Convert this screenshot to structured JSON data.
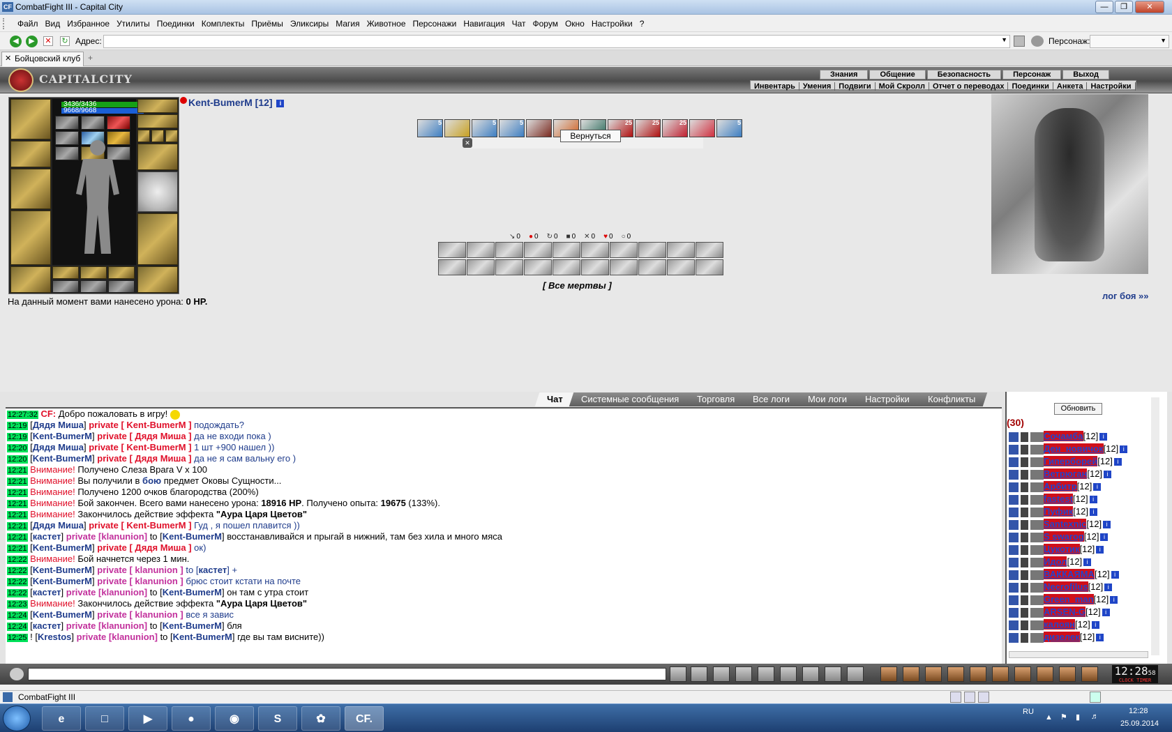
{
  "window": {
    "title": "CombatFight III - Capital City",
    "icon_label": "CF"
  },
  "menu": [
    "Файл",
    "Вид",
    "Избранное",
    "Утилиты",
    "Поединки",
    "Комплекты",
    "Приёмы",
    "Эликсиры",
    "Магия",
    "Животное",
    "Персонажи",
    "Навигация",
    "Чат",
    "Форум",
    "Окно",
    "Настройки",
    "?"
  ],
  "address": {
    "label": "Адрес:",
    "value": "",
    "character_label": "Персонаж:"
  },
  "tab": {
    "label": "Бойцовский клуб"
  },
  "game": {
    "logo": "CAPITALCITY",
    "nav_top": [
      "Знания",
      "Общение",
      "Безопасность",
      "Персонаж",
      "Выход"
    ],
    "nav_bottom": [
      "Инвентарь",
      "Умения",
      "Подвиги",
      "Мой Скролл",
      "Отчет о переводах",
      "Поединки",
      "Анкета",
      "Настройки"
    ],
    "hp": "3436/3436",
    "mp": "9668/9668",
    "character": {
      "name": "Kent-BumerM",
      "level": "[12]"
    },
    "buff_counts": [
      "5",
      "",
      "5",
      "5",
      "",
      "",
      "",
      "25",
      "25",
      "25",
      "",
      "5"
    ],
    "return_button": "Вернуться",
    "stats": [
      "0",
      "0",
      "0",
      "0",
      "0",
      "0",
      "0"
    ],
    "all_dead": "[ Все мертвы ]",
    "damage_prefix": "На данный момент вами нанесено урона: ",
    "damage_value": "0 HP.",
    "battle_log_link": "лог боя »»"
  },
  "chat_tabs": [
    "Чат",
    "Системные сообщения",
    "Торговля",
    "Все логи",
    "Мои логи",
    "Настройки",
    "Конфликты"
  ],
  "chat": [
    {
      "t": "12:27:32",
      "parts": [
        {
          "c": "pr",
          "x": "CF:"
        },
        {
          "c": "tn",
          "x": " Добро пожаловать в игру!"
        }
      ]
    },
    {
      "t": "12:19",
      "parts": [
        {
          "c": "tn",
          "x": "["
        },
        {
          "c": "nm",
          "x": "Дядя Миша"
        },
        {
          "c": "tn",
          "x": "] "
        },
        {
          "c": "pr",
          "x": "private [ Kent-BumerM ]"
        },
        {
          "c": "bl",
          "x": " подождать?"
        }
      ]
    },
    {
      "t": "12:19",
      "parts": [
        {
          "c": "tn",
          "x": "["
        },
        {
          "c": "nm",
          "x": "Kent-BumerM"
        },
        {
          "c": "tn",
          "x": "] "
        },
        {
          "c": "pr",
          "x": "private [ Дядя Миша ]"
        },
        {
          "c": "bl",
          "x": " да не входи пока )"
        }
      ]
    },
    {
      "t": "12:20",
      "parts": [
        {
          "c": "tn",
          "x": "["
        },
        {
          "c": "nm",
          "x": "Дядя Миша"
        },
        {
          "c": "tn",
          "x": "] "
        },
        {
          "c": "pr",
          "x": "private [ Kent-BumerM ]"
        },
        {
          "c": "bl",
          "x": " 1 шт +900 нашел ))"
        }
      ]
    },
    {
      "t": "12:20",
      "parts": [
        {
          "c": "tn",
          "x": "["
        },
        {
          "c": "nm",
          "x": "Kent-BumerM"
        },
        {
          "c": "tn",
          "x": "] "
        },
        {
          "c": "pr",
          "x": "private [ Дядя Миша ]"
        },
        {
          "c": "bl",
          "x": " да не я сам вальну его )"
        }
      ]
    },
    {
      "t": "12:21",
      "parts": [
        {
          "c": "warn",
          "x": "Внимание!"
        },
        {
          "c": "tn",
          "x": " Получено Слеза Врага V x 100"
        }
      ]
    },
    {
      "t": "12:21",
      "parts": [
        {
          "c": "warn",
          "x": "Внимание!"
        },
        {
          "c": "tn",
          "x": " Вы получили в "
        },
        {
          "c": "nm",
          "x": "бою"
        },
        {
          "c": "tn",
          "x": " предмет Оковы Сущности..."
        }
      ]
    },
    {
      "t": "12:21",
      "parts": [
        {
          "c": "warn",
          "x": "Внимание!"
        },
        {
          "c": "tn",
          "x": " Получено 1200 очков благородства (200%)"
        }
      ]
    },
    {
      "t": "12:21",
      "parts": [
        {
          "c": "warn",
          "x": "Внимание!"
        },
        {
          "c": "tn",
          "x": " Бой закончен. Всего вами нанесено урона: "
        },
        {
          "c": "b",
          "x": "18916 HP"
        },
        {
          "c": "tn",
          "x": ". Получено опыта: "
        },
        {
          "c": "b",
          "x": "19675"
        },
        {
          "c": "tn",
          "x": " (133%)."
        }
      ]
    },
    {
      "t": "12:21",
      "parts": [
        {
          "c": "warn",
          "x": "Внимание!"
        },
        {
          "c": "tn",
          "x": " Закончилось действие эффекта "
        },
        {
          "c": "b",
          "x": "\"Аура Царя Цветов\""
        }
      ]
    },
    {
      "t": "12:21",
      "parts": [
        {
          "c": "tn",
          "x": "["
        },
        {
          "c": "nm",
          "x": "Дядя Миша"
        },
        {
          "c": "tn",
          "x": "] "
        },
        {
          "c": "pr",
          "x": "private [ Kent-BumerM ]"
        },
        {
          "c": "bl",
          "x": " Гуд , я пошел плавится ))"
        }
      ]
    },
    {
      "t": "12:21",
      "parts": [
        {
          "c": "tn",
          "x": "["
        },
        {
          "c": "nm",
          "x": "кастет"
        },
        {
          "c": "tn",
          "x": "] "
        },
        {
          "c": "pp",
          "x": "private [klanunion]"
        },
        {
          "c": "tn",
          "x": " to ["
        },
        {
          "c": "nm",
          "x": "Kent-BumerM"
        },
        {
          "c": "tn",
          "x": "] восстанавливайся и прыгай в нижний, там без хила и много мяса"
        }
      ]
    },
    {
      "t": "12:21",
      "parts": [
        {
          "c": "tn",
          "x": "["
        },
        {
          "c": "nm",
          "x": "Kent-BumerM"
        },
        {
          "c": "tn",
          "x": "] "
        },
        {
          "c": "pr",
          "x": "private [ Дядя Миша ]"
        },
        {
          "c": "bl",
          "x": " ок)"
        }
      ]
    },
    {
      "t": "12:22",
      "parts": [
        {
          "c": "warn",
          "x": "Внимание!"
        },
        {
          "c": "tn",
          "x": " Бой начнется через 1 мин."
        }
      ]
    },
    {
      "t": "12:22",
      "parts": [
        {
          "c": "tn",
          "x": "["
        },
        {
          "c": "nm",
          "x": "Kent-BumerM"
        },
        {
          "c": "tn",
          "x": "] "
        },
        {
          "c": "pp",
          "x": "private [ klanunion ]"
        },
        {
          "c": "bl",
          "x": " to ["
        },
        {
          "c": "nm",
          "x": "кастет"
        },
        {
          "c": "bl",
          "x": "] +"
        }
      ]
    },
    {
      "t": "12:22",
      "parts": [
        {
          "c": "tn",
          "x": "["
        },
        {
          "c": "nm",
          "x": "Kent-BumerM"
        },
        {
          "c": "tn",
          "x": "] "
        },
        {
          "c": "pp",
          "x": "private [ klanunion ]"
        },
        {
          "c": "bl",
          "x": " брюс стоит кстати на почте"
        }
      ]
    },
    {
      "t": "12:22",
      "parts": [
        {
          "c": "tn",
          "x": "["
        },
        {
          "c": "nm",
          "x": "кастет"
        },
        {
          "c": "tn",
          "x": "] "
        },
        {
          "c": "pp",
          "x": "private [klanunion]"
        },
        {
          "c": "tn",
          "x": " to ["
        },
        {
          "c": "nm",
          "x": "Kent-BumerM"
        },
        {
          "c": "tn",
          "x": "] он там с утра стоит"
        }
      ]
    },
    {
      "t": "12:23",
      "parts": [
        {
          "c": "warn",
          "x": "Внимание!"
        },
        {
          "c": "tn",
          "x": " Закончилось действие эффекта "
        },
        {
          "c": "b",
          "x": "\"Аура Царя Цветов\""
        }
      ]
    },
    {
      "t": "12:24",
      "parts": [
        {
          "c": "tn",
          "x": "["
        },
        {
          "c": "nm",
          "x": "Kent-BumerM"
        },
        {
          "c": "tn",
          "x": "] "
        },
        {
          "c": "pp",
          "x": "private [ klanunion ]"
        },
        {
          "c": "bl",
          "x": " все я завис"
        }
      ]
    },
    {
      "t": "12:24",
      "parts": [
        {
          "c": "tn",
          "x": "["
        },
        {
          "c": "nm",
          "x": "кастет"
        },
        {
          "c": "tn",
          "x": "] "
        },
        {
          "c": "pp",
          "x": "private [klanunion]"
        },
        {
          "c": "tn",
          "x": " to ["
        },
        {
          "c": "nm",
          "x": "Kent-BumerM"
        },
        {
          "c": "tn",
          "x": "] бля"
        }
      ]
    },
    {
      "t": "12:25",
      "parts": [
        {
          "c": "tn",
          "x": "! ["
        },
        {
          "c": "nm",
          "x": "Krestos"
        },
        {
          "c": "tn",
          "x": "] "
        },
        {
          "c": "pp",
          "x": "private [klanunion]"
        },
        {
          "c": "tn",
          "x": " to ["
        },
        {
          "c": "nm",
          "x": "Kent-BumerM"
        },
        {
          "c": "tn",
          "x": "] где вы там висните))"
        }
      ]
    }
  ],
  "online": {
    "refresh": "Обновить",
    "count": "(30)",
    "users": [
      {
        "name": "Сочамба",
        "level": "[12]"
      },
      {
        "name": "Ден_новичок",
        "level": "[12]"
      },
      {
        "name": "Гиперборей",
        "level": "[12]"
      },
      {
        "name": "Ветрюган",
        "level": "[12]"
      },
      {
        "name": "Арбитр",
        "level": "[12]"
      },
      {
        "name": "fastest",
        "level": "[12]"
      },
      {
        "name": "Пуфик",
        "level": "[12]"
      },
      {
        "name": "Santexnic",
        "level": "[12]"
      },
      {
        "name": "S swarog",
        "level": "[12]"
      },
      {
        "name": "Цукотик",
        "level": "[12]"
      },
      {
        "name": "Идол",
        "level": "[12]"
      },
      {
        "name": "ВАККАЯМА",
        "level": "[12]"
      },
      {
        "name": "Necrofilus",
        "level": "[12]"
      },
      {
        "name": "Green_man",
        "level": "[12]"
      },
      {
        "name": "ARSEN-G",
        "level": "[12]"
      },
      {
        "name": "калоян",
        "level": "[12]"
      },
      {
        "name": "дизелек",
        "level": "[12]"
      }
    ]
  },
  "clock": {
    "time": "12:28",
    "seconds": "58",
    "sub": "CLOCK TIMER"
  },
  "statusbar": {
    "text": "CombatFight III"
  },
  "taskbar": {
    "lang": "RU",
    "time": "12:28",
    "date": "25.09.2014",
    "active_app": "CF."
  }
}
